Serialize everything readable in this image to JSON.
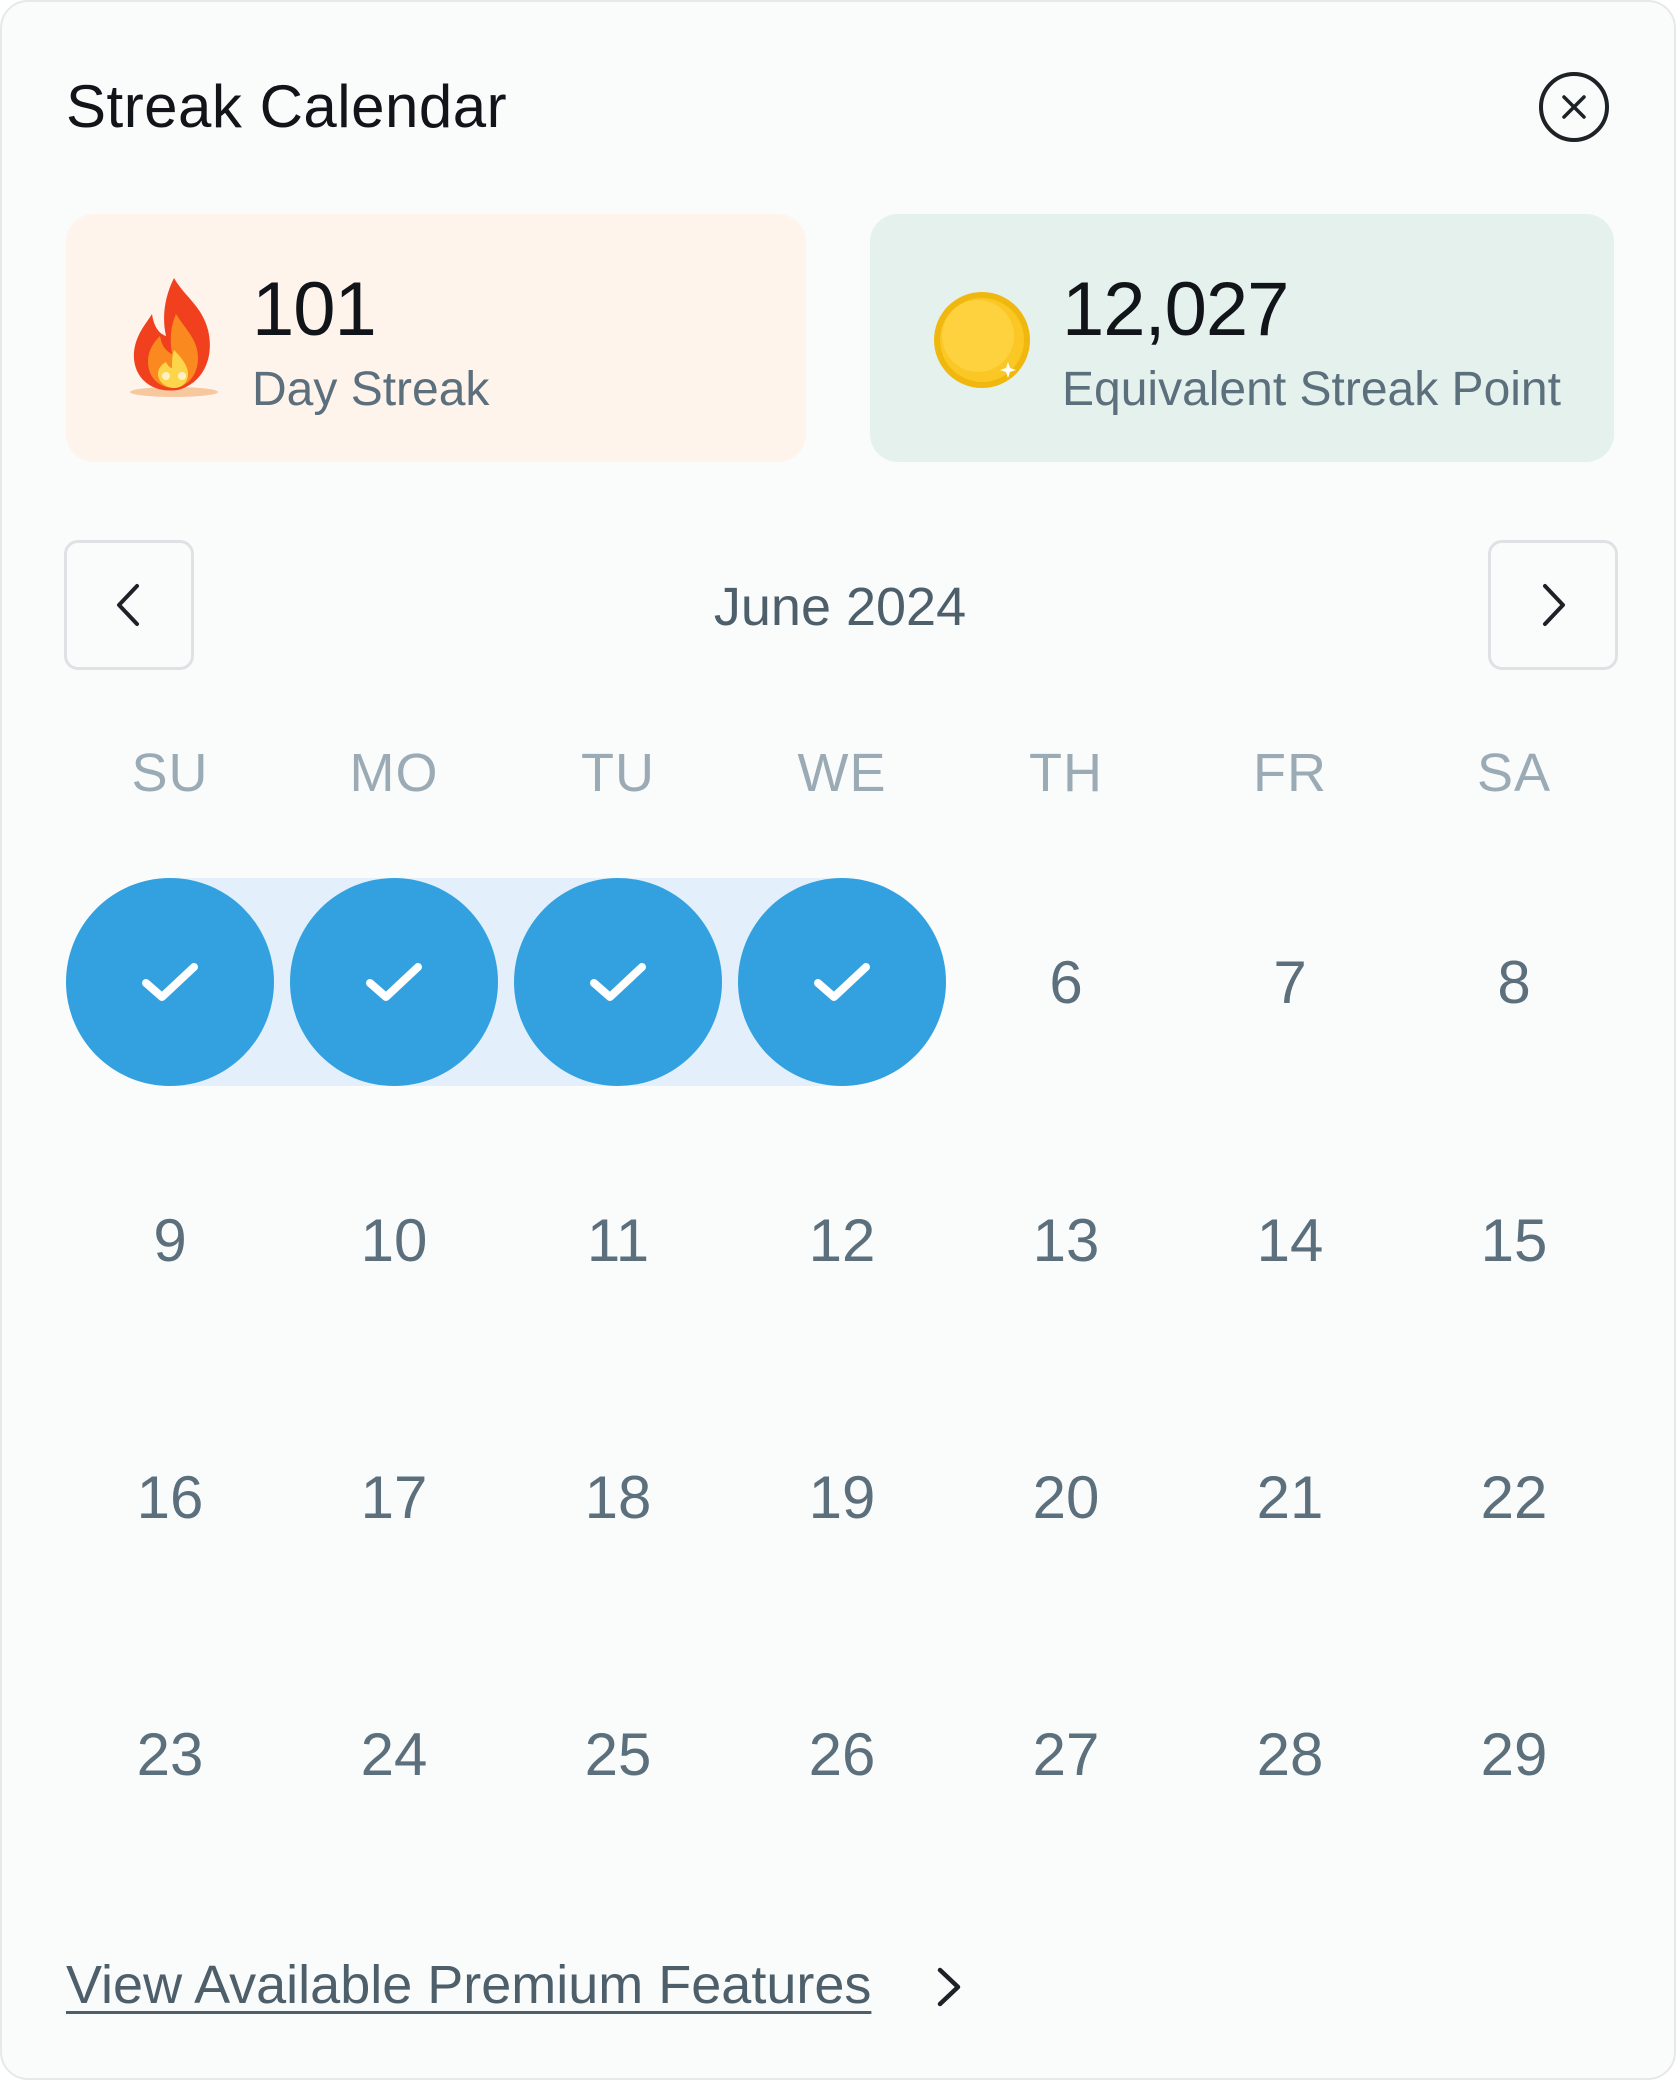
{
  "header": {
    "title": "Streak Calendar"
  },
  "stats": {
    "streak": {
      "value": "101",
      "label": "Day Streak",
      "icon": "flame-icon"
    },
    "points": {
      "value": "12,027",
      "label": "Equivalent Streak Point",
      "icon": "coin-icon"
    }
  },
  "calendar": {
    "month_label": "June 2024",
    "weekdays": [
      "SU",
      "MO",
      "TU",
      "WE",
      "TH",
      "FR",
      "SA"
    ],
    "weeks": [
      [
        "✓",
        "✓",
        "✓",
        "✓",
        "6",
        "7",
        "8"
      ],
      [
        "9",
        "10",
        "11",
        "12",
        "13",
        "14",
        "15"
      ],
      [
        "16",
        "17",
        "18",
        "19",
        "20",
        "21",
        "22"
      ],
      [
        "23",
        "24",
        "25",
        "26",
        "27",
        "28",
        "29"
      ]
    ],
    "checked_days": [
      "SU",
      "MO",
      "TU",
      "WE"
    ]
  },
  "footer": {
    "link_label": "View Available Premium Features"
  },
  "colors": {
    "accent": "#33a1e0",
    "streak_band": "#e3f0fb",
    "streak_card": "#fef4ec",
    "points_card": "#e5f1ec"
  }
}
